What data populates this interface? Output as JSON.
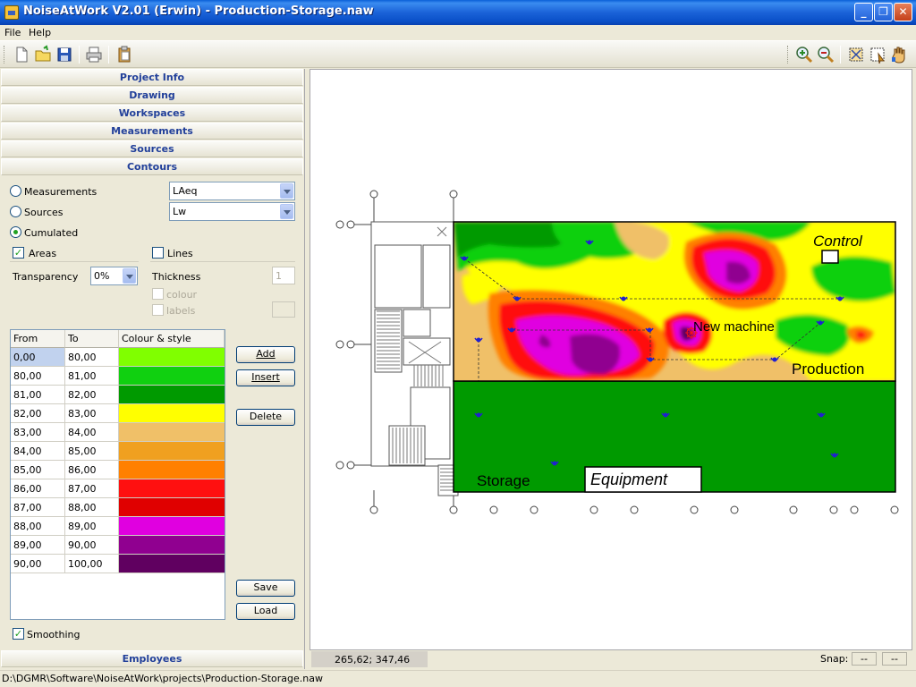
{
  "window": {
    "title": "NoiseAtWork V2.01 (Erwin) - Production-Storage.naw",
    "minimize": "_",
    "maximize": "❐",
    "close": "✕"
  },
  "menu": {
    "file": "File",
    "help": "Help"
  },
  "toolbar": {
    "icons": [
      "new-file-icon",
      "open-folder-icon",
      "save-icon",
      "print-icon",
      "clipboard-icon",
      "zoom-in-icon",
      "zoom-out-icon",
      "fit-view-icon",
      "select-area-icon",
      "pan-icon"
    ]
  },
  "panel": {
    "sections": [
      "Project Info",
      "Drawing",
      "Workspaces",
      "Measurements",
      "Sources",
      "Contours"
    ],
    "bottom_section": "Employees"
  },
  "contours": {
    "measurements_label": "Measurements",
    "measurements_value": "LAeq",
    "sources_label": "Sources",
    "sources_value": "Lw",
    "cumulated_label": "Cumulated",
    "selected_mode": "Cumulated",
    "areas_label": "Areas",
    "areas_checked": true,
    "lines_label": "Lines",
    "lines_checked": false,
    "transparency_label": "Transparency",
    "transparency_value": "0%",
    "thickness_label": "Thickness",
    "thickness_value": "1",
    "colour_label": "colour",
    "labels_label": "labels",
    "smoothing_label": "Smoothing",
    "smoothing_checked": true
  },
  "grid": {
    "headers": [
      "From",
      "To",
      "Colour & style"
    ],
    "rows": [
      {
        "from": "0,00",
        "to": "80,00",
        "color": "#80ff00"
      },
      {
        "from": "80,00",
        "to": "81,00",
        "color": "#10d010"
      },
      {
        "from": "81,00",
        "to": "82,00",
        "color": "#009a00"
      },
      {
        "from": "82,00",
        "to": "83,00",
        "color": "#ffff00"
      },
      {
        "from": "83,00",
        "to": "84,00",
        "color": "#f0c068"
      },
      {
        "from": "84,00",
        "to": "85,00",
        "color": "#f0a020"
      },
      {
        "from": "85,00",
        "to": "86,00",
        "color": "#ff8000"
      },
      {
        "from": "86,00",
        "to": "87,00",
        "color": "#ff1010"
      },
      {
        "from": "87,00",
        "to": "88,00",
        "color": "#e00000"
      },
      {
        "from": "88,00",
        "to": "89,00",
        "color": "#e000e0"
      },
      {
        "from": "89,00",
        "to": "90,00",
        "color": "#900090"
      },
      {
        "from": "90,00",
        "to": "100,00",
        "color": "#600060"
      }
    ]
  },
  "buttons": {
    "add": "Add",
    "insert": "Insert",
    "delete": "Delete",
    "save": "Save",
    "load": "Load"
  },
  "drawing": {
    "labels": {
      "control": "Control",
      "new_machine": "New machine",
      "production": "Production",
      "storage": "Storage",
      "equipment": "Equipment"
    }
  },
  "status": {
    "coords": "265,62; 347,46",
    "snap_label": "Snap:",
    "snap_x": "--",
    "snap_y": "--"
  },
  "path": "D:\\DGMR\\Software\\NoiseAtWork\\projects\\Production-Storage.naw"
}
